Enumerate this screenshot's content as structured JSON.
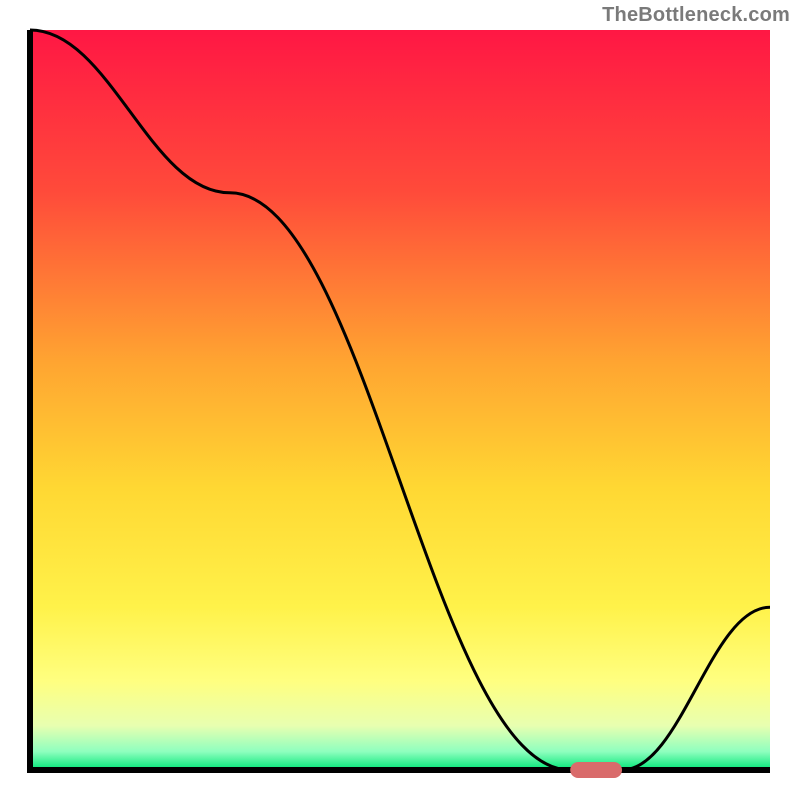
{
  "attribution": "TheBottleneck.com",
  "chart_data": {
    "type": "line",
    "title": "",
    "xlabel": "",
    "ylabel": "",
    "xlim": [
      0,
      100
    ],
    "ylim": [
      0,
      100
    ],
    "x": [
      0,
      27,
      73,
      80,
      100
    ],
    "values": [
      100,
      78,
      0,
      0,
      22
    ],
    "marker": {
      "x_start": 73,
      "x_end": 80,
      "y": 0,
      "color": "#d96b6b"
    },
    "gradient_stops": [
      {
        "offset": 0.0,
        "color": "#ff1744"
      },
      {
        "offset": 0.22,
        "color": "#ff4b3a"
      },
      {
        "offset": 0.45,
        "color": "#ffa531"
      },
      {
        "offset": 0.62,
        "color": "#ffd833"
      },
      {
        "offset": 0.78,
        "color": "#fff24a"
      },
      {
        "offset": 0.88,
        "color": "#ffff80"
      },
      {
        "offset": 0.94,
        "color": "#e8ffb0"
      },
      {
        "offset": 0.975,
        "color": "#8fffbf"
      },
      {
        "offset": 1.0,
        "color": "#00e676"
      }
    ],
    "axis_color": "#000000",
    "curve_color": "#000000",
    "curve_width": 3
  }
}
